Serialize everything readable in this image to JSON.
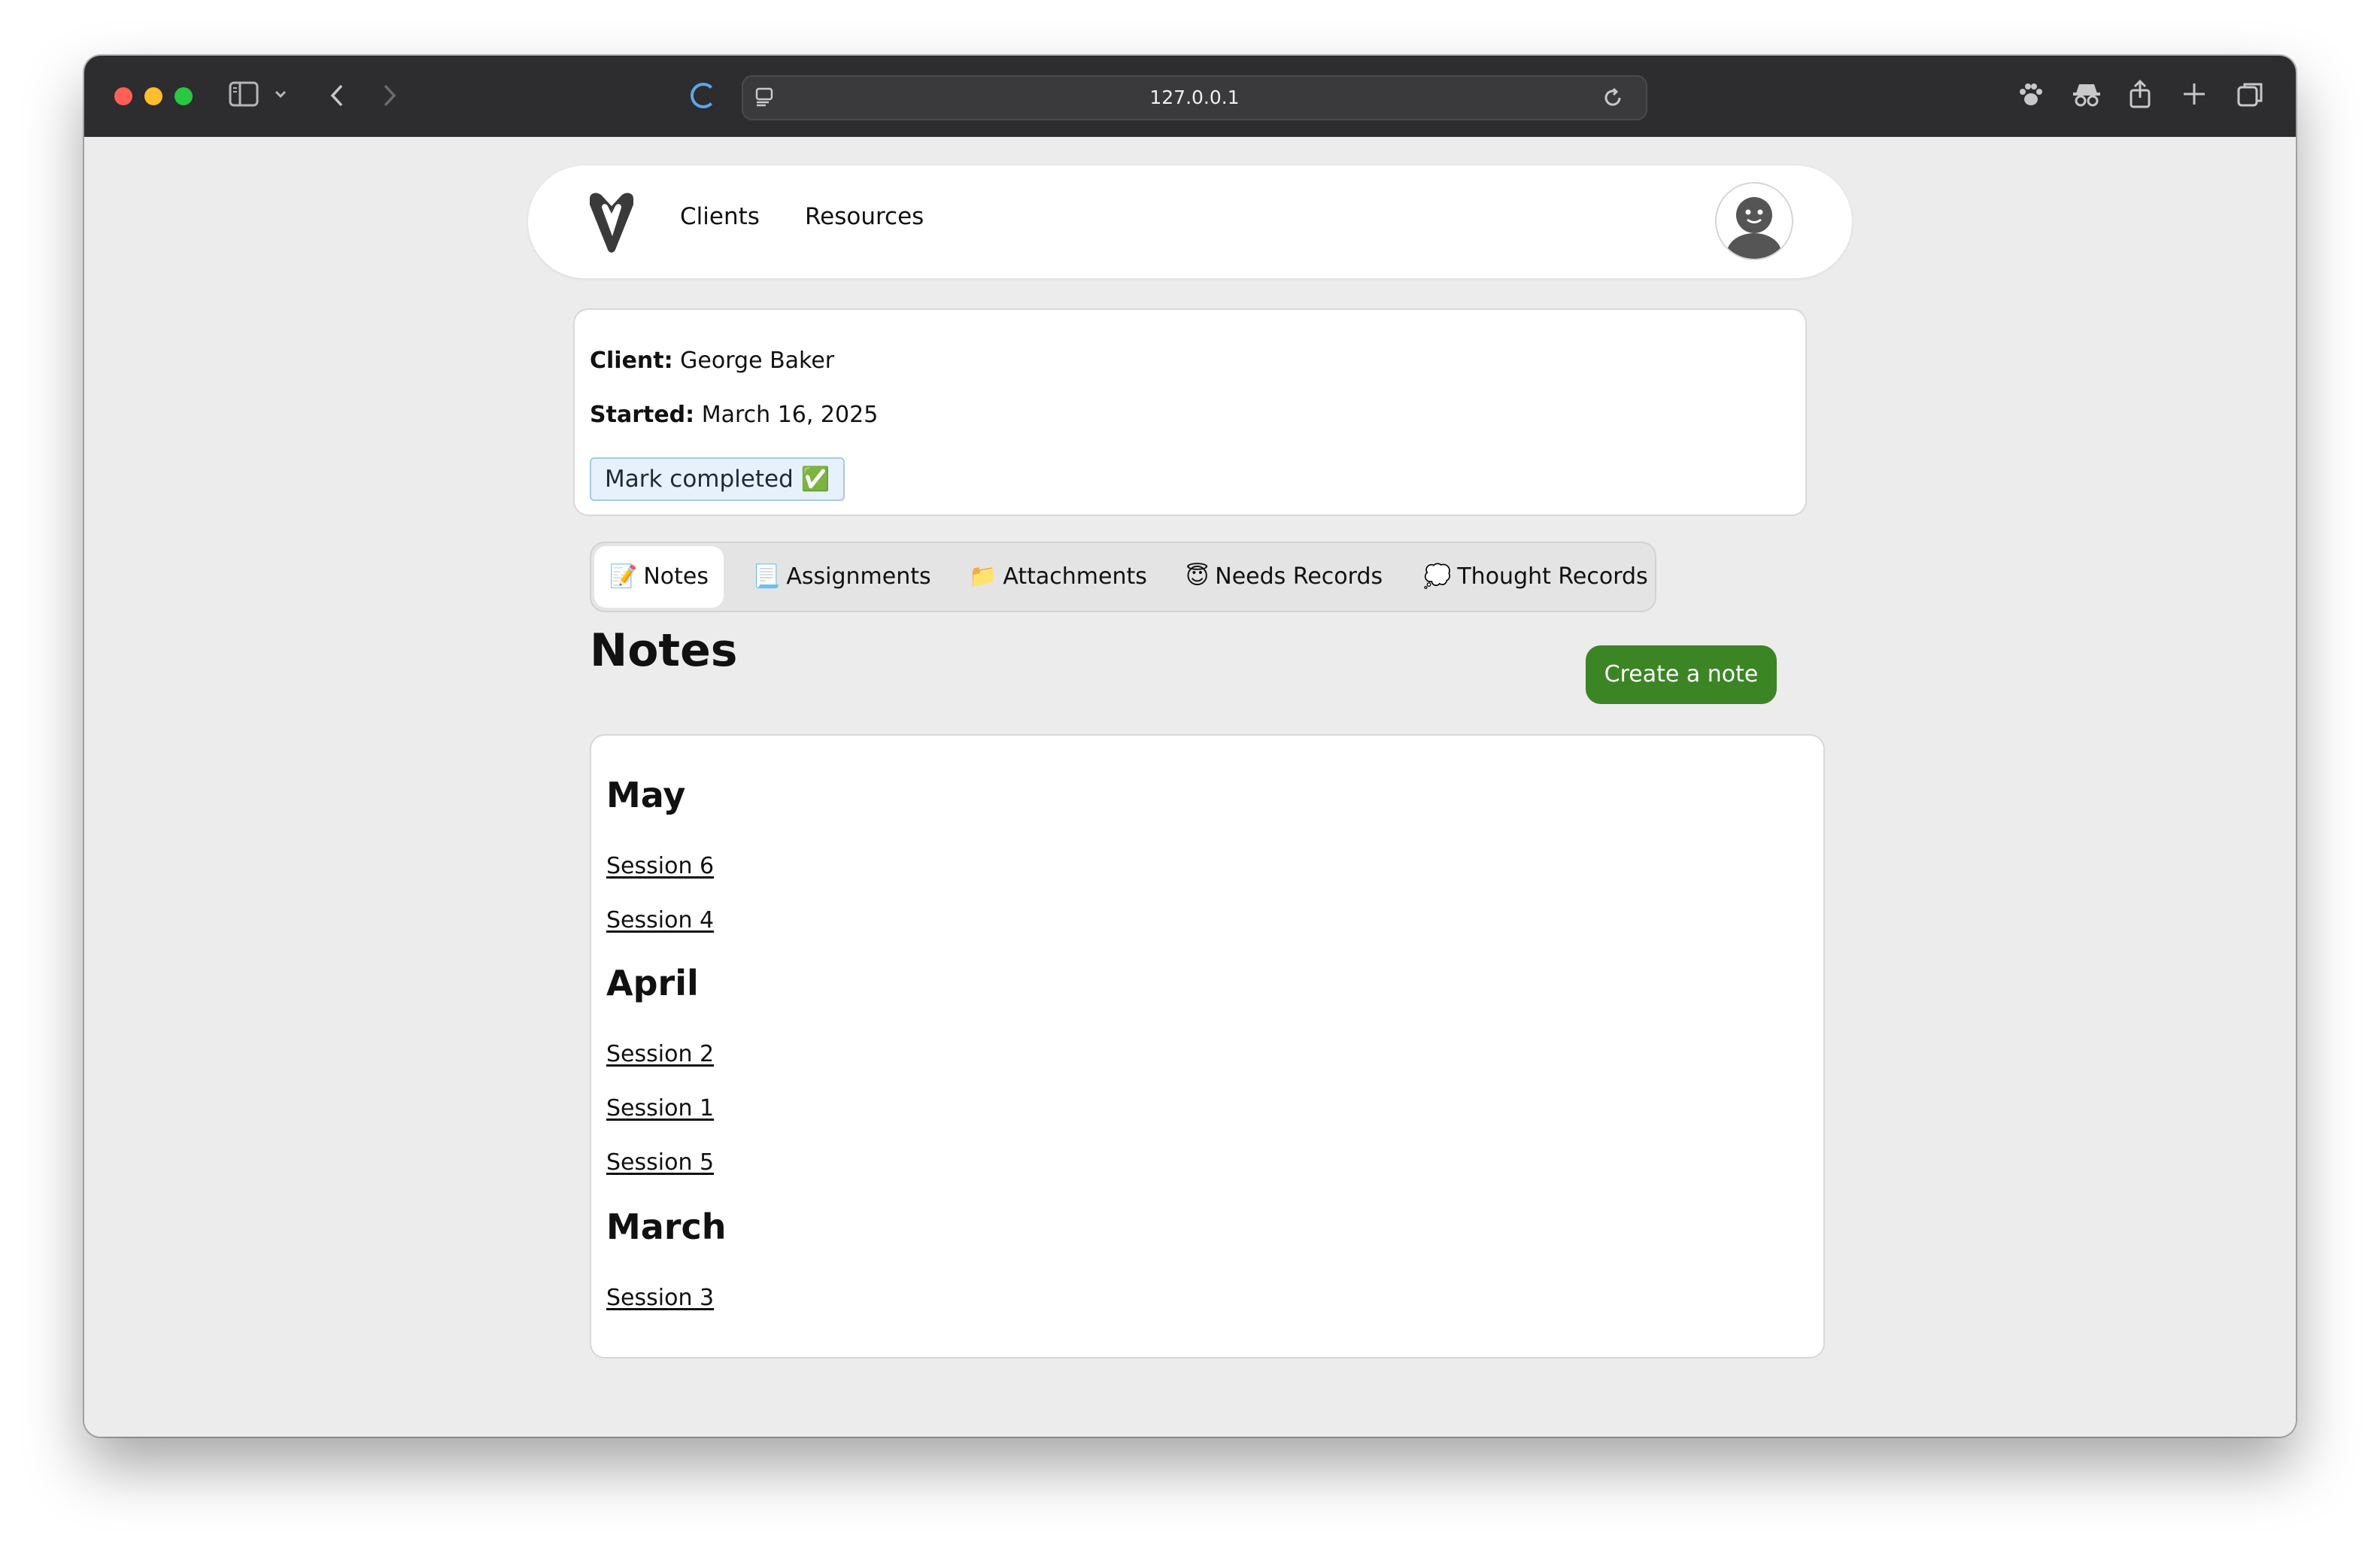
{
  "browser": {
    "url": "127.0.0.1"
  },
  "nav": {
    "links": [
      "Clients",
      "Resources"
    ]
  },
  "client": {
    "client_label": "Client:",
    "client_name": "George Baker",
    "started_label": "Started:",
    "started_date": "March 16, 2025",
    "mark_completed": "Mark completed ✅"
  },
  "tabs": [
    {
      "emoji": "📝",
      "label": "Notes"
    },
    {
      "emoji": "📃",
      "label": "Assignments"
    },
    {
      "emoji": "📁",
      "label": "Attachments"
    },
    {
      "emoji": "😇",
      "label": "Needs Records"
    },
    {
      "emoji": "💭",
      "label": "Thought Records"
    }
  ],
  "notes": {
    "title": "Notes",
    "create_button": "Create a note",
    "groups": [
      {
        "month": "May",
        "sessions": [
          "Session 6",
          "Session 4"
        ]
      },
      {
        "month": "April",
        "sessions": [
          "Session 2",
          "Session 1",
          "Session 5"
        ]
      },
      {
        "month": "March",
        "sessions": [
          "Session 3"
        ]
      }
    ]
  },
  "colors": {
    "accent_green": "#3b8525",
    "mark_button_bg": "#e6f1fb",
    "page_bg": "#ececec"
  }
}
